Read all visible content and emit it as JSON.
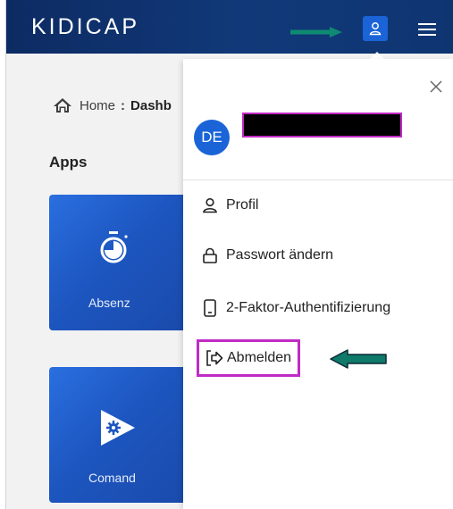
{
  "header": {
    "logo": "KIDICAP",
    "user_icon": "user-icon",
    "menu_icon": "hamburger-icon"
  },
  "breadcrumb": {
    "home": "Home",
    "separator": ":",
    "current": "Dashb"
  },
  "apps": {
    "title": "Apps",
    "tiles": [
      {
        "label": "Absenz",
        "icon": "stopwatch-icon"
      },
      {
        "label": "Comand",
        "icon": "play-gear-icon"
      }
    ]
  },
  "user_menu": {
    "avatar_initials": "DE",
    "items": [
      {
        "label": "Profil",
        "icon": "user-icon"
      },
      {
        "label": "Passwort ändern",
        "icon": "lock-icon"
      },
      {
        "label": "2-Faktor-Authentifizierung",
        "icon": "phone-icon"
      },
      {
        "label": "Abmelden",
        "icon": "logout-icon"
      }
    ]
  },
  "colors": {
    "header_bg": "#113979",
    "accent": "#1a64d8",
    "highlight": "#c02bc5",
    "annotation_arrow": "#0f7a6a"
  }
}
